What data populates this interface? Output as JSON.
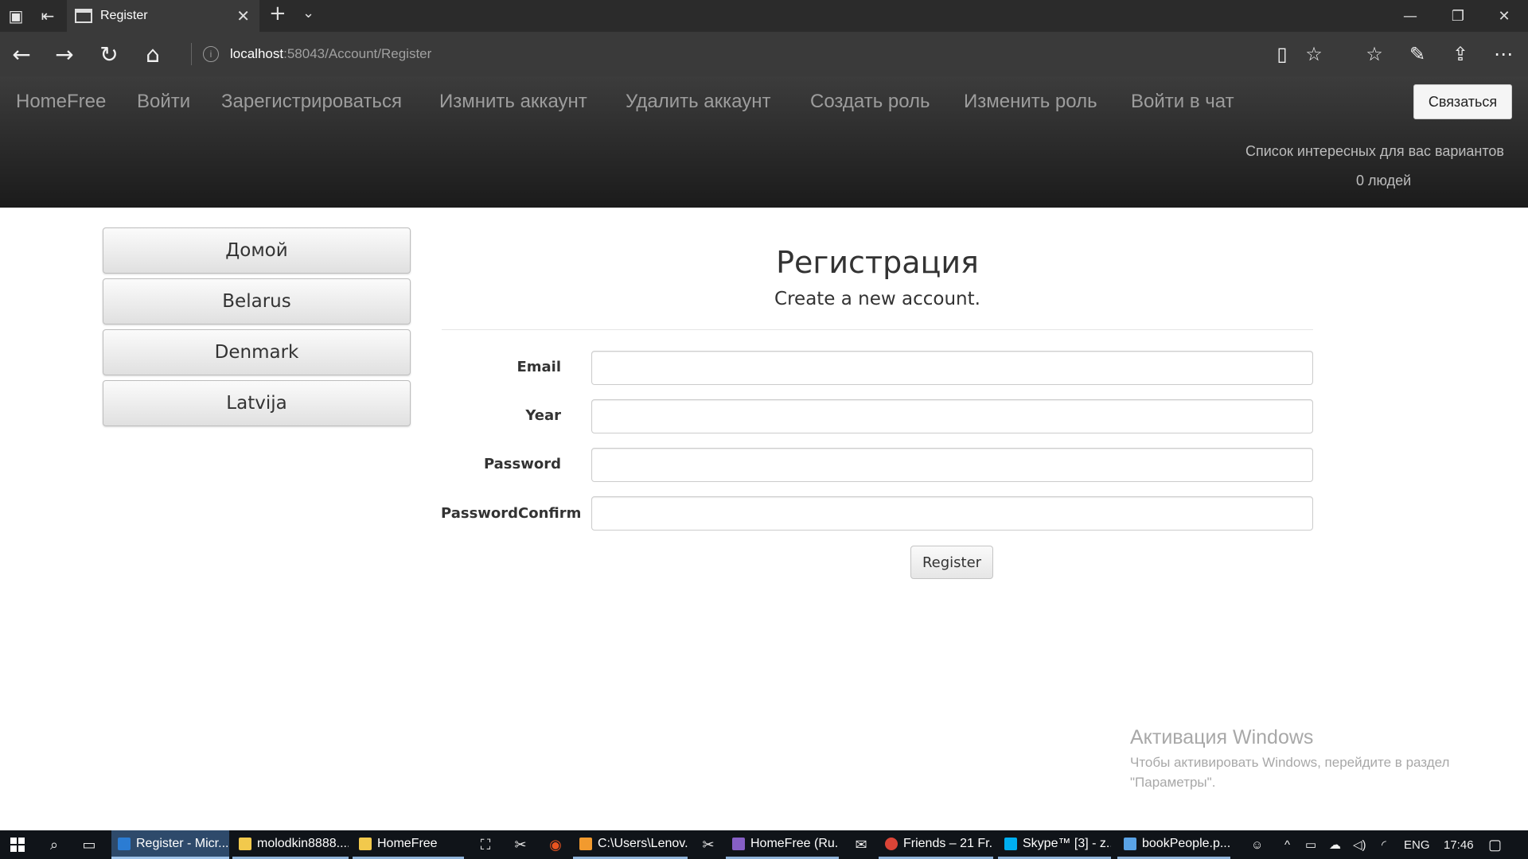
{
  "browser": {
    "tab_title": "Register",
    "tab_close": "✕",
    "new_tab": "+",
    "tab_dropdown": "⌄",
    "window_buttons": [
      "—",
      "❐",
      "✕"
    ],
    "url_host": "localhost",
    "url_path": ":58043/Account/Register",
    "info_glyph": "i",
    "nav_icons": {
      "back": "←",
      "forward": "→",
      "refresh": "↻",
      "home": "⌂"
    },
    "toolbar_icons": {
      "reading_view": "▯",
      "favorite": "☆",
      "favorites_hub": "☆",
      "notes": "✎",
      "share": "⇪",
      "more": "⋯"
    }
  },
  "navbar": {
    "brand": "HomeFree",
    "items": [
      "Войти",
      "Зарегистрироваться",
      "Измнить аккаунт",
      "Удалить аккаунт",
      "Создать роль",
      "Изменить роль",
      "Войти в чат"
    ],
    "contact_button": "Связаться",
    "list_text": "Список интересных для вас вариантов",
    "count_text": "0 людей"
  },
  "sidebar": {
    "items": [
      "Домой",
      "Belarus",
      "Denmark",
      "Latvija"
    ]
  },
  "form": {
    "title": "Регистрация",
    "subtitle": "Create a new account.",
    "fields": [
      "Email",
      "Year",
      "Password",
      "PasswordConfirm"
    ],
    "submit": "Register"
  },
  "watermark": {
    "title": "Активация Windows",
    "text": "Чтобы активировать Windows, перейдите в раздел \"Параметры\"."
  },
  "taskbar": {
    "items": [
      "Register - Micr...",
      "molodkin8888....",
      "HomeFree",
      "C:\\Users\\Lenov...",
      "HomeFree (Ru...",
      "Friends – 21 Fr...",
      "Skype™ [3] - z...",
      "bookPeople.p..."
    ],
    "language": "ENG",
    "time": "17:46",
    "tray_icons": {
      "people": "☺",
      "chevron": "^",
      "battery": "▭",
      "cloud": "☁",
      "volume": "◁)",
      "wifi": "◜",
      "notifications": "▢"
    }
  }
}
